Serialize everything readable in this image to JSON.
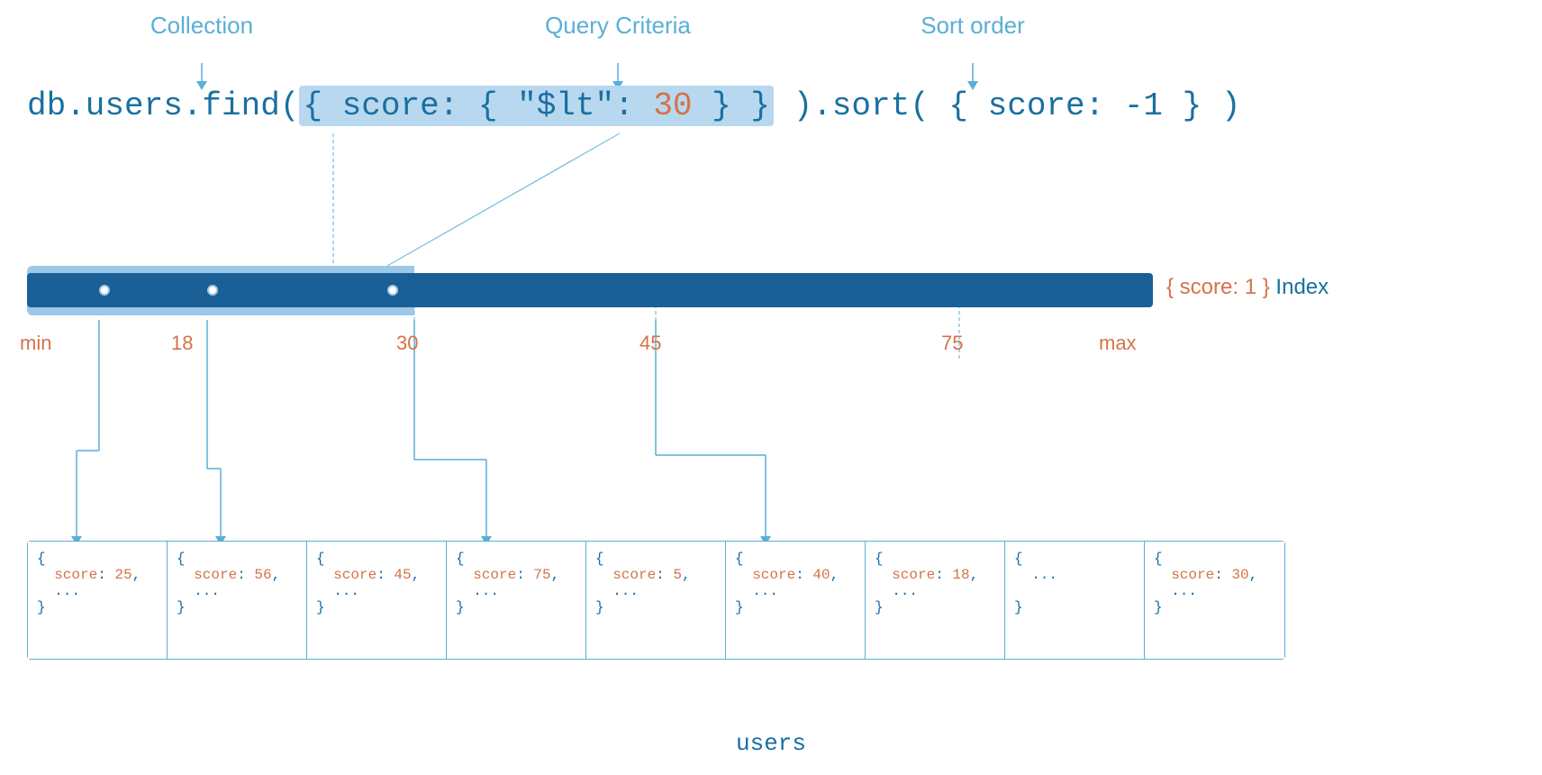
{
  "labels": {
    "collection": "Collection",
    "query_criteria": "Query Criteria",
    "sort_order": "Sort order"
  },
  "code": {
    "prefix": "db.users.find(",
    "highlight": "{ score: { \"$lt\": 30 } }",
    "number": "30",
    "suffix": " ).sort( { score: -1 } )"
  },
  "index": {
    "label_prefix": "{ score: 1 }",
    "label_suffix": "Index"
  },
  "scale": {
    "min": "min",
    "v18": "18",
    "v30": "30",
    "v45": "45",
    "v75": "75",
    "max": "max"
  },
  "documents": [
    {
      "score": 25
    },
    {
      "score": 56
    },
    {
      "score": 45
    },
    {
      "score": 75
    },
    {
      "score": 5
    },
    {
      "score": 40
    },
    {
      "score": 18
    },
    {
      "score": null
    },
    {
      "score": 30
    }
  ],
  "collection_name": "users",
  "colors": {
    "blue_light": "#9dc8e8",
    "blue_dark": "#1a5f96",
    "blue_text": "#1a6fa0",
    "blue_label": "#5aafd6",
    "orange": "#d4734a"
  }
}
